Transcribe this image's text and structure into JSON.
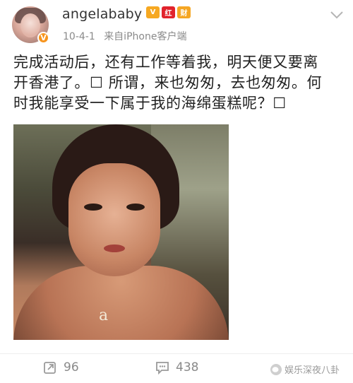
{
  "header": {
    "username": "angelababy",
    "badges": [
      "V",
      "红",
      "财"
    ],
    "time": "10-4-1",
    "source": "来自iPhone客户端"
  },
  "post": {
    "lines": [
      "完成活动后，还有工作等着我，明天便又要离",
      "开香港了。☐ 所谓，来也匆匆，去也匆匆。何",
      "时我能享受一下属于我的海绵蛋糕呢？☐"
    ],
    "image_pendant": "a"
  },
  "footer": {
    "repost_count": "96",
    "comment_count": "438",
    "watermark": "娱乐深夜八卦"
  }
}
